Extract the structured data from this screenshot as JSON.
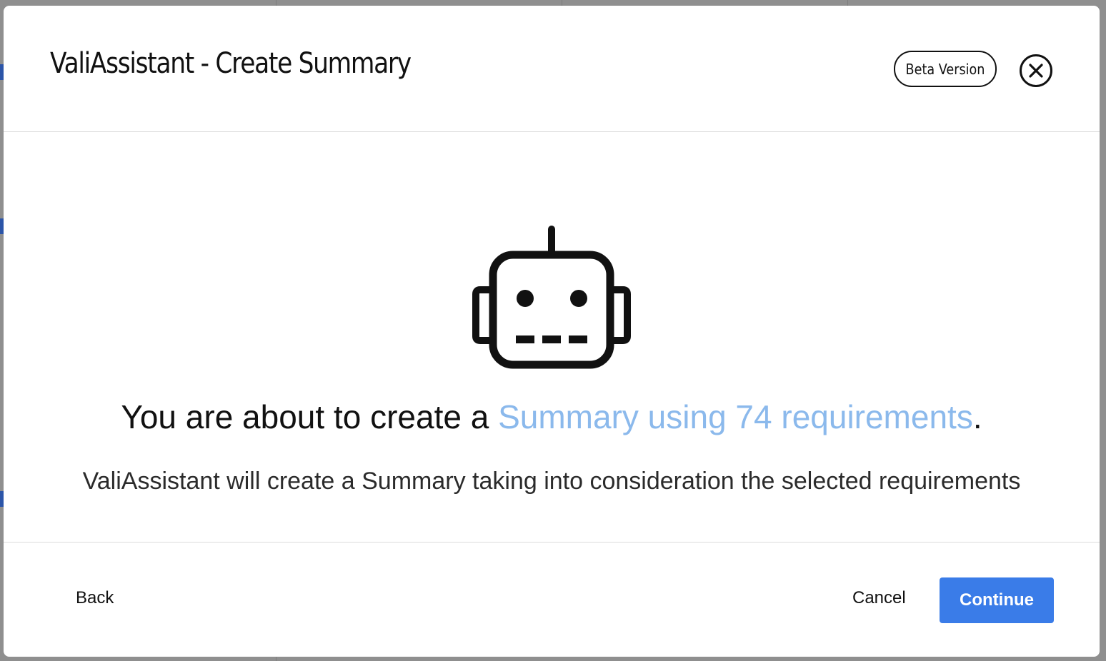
{
  "dialog": {
    "title": "ValiAssistant - Create Summary",
    "badge": "Beta Version",
    "close_icon": "close-circle-icon",
    "illustration_icon": "robot-icon"
  },
  "message": {
    "prefix": "You are about to create a ",
    "highlight": "Summary using 74 requirements",
    "suffix": ".",
    "description": "ValiAssistant will create a Summary taking into consideration the selected requirements"
  },
  "footer": {
    "back_label": "Back",
    "cancel_label": "Cancel",
    "continue_label": "Continue"
  },
  "colors": {
    "accent": "#3a7ce8",
    "highlight": "#8bb9ec",
    "backdrop": "#8f8f8f"
  }
}
